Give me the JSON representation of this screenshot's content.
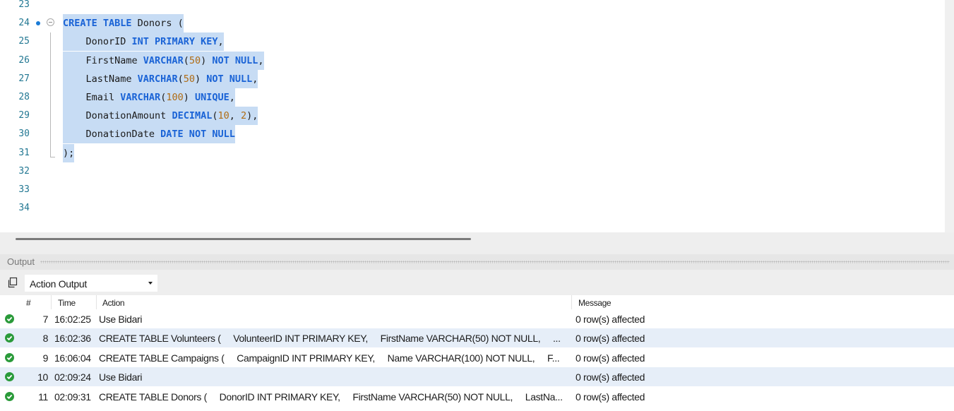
{
  "editor": {
    "lines": [
      {
        "n": "23",
        "tokens": []
      },
      {
        "n": "24",
        "tokens": [
          {
            "t": "CREATE TABLE",
            "c": "kw"
          },
          {
            "t": " Donors (",
            "c": "tx"
          }
        ]
      },
      {
        "n": "25",
        "tokens": [
          {
            "t": "    DonorID ",
            "c": "tx"
          },
          {
            "t": "INT PRIMARY KEY",
            "c": "kw"
          },
          {
            "t": ",",
            "c": "tx"
          }
        ]
      },
      {
        "n": "26",
        "tokens": [
          {
            "t": "    FirstName ",
            "c": "tx"
          },
          {
            "t": "VARCHAR",
            "c": "kw"
          },
          {
            "t": "(",
            "c": "tx"
          },
          {
            "t": "50",
            "c": "num"
          },
          {
            "t": ") ",
            "c": "tx"
          },
          {
            "t": "NOT NULL",
            "c": "kw"
          },
          {
            "t": ",",
            "c": "tx"
          }
        ]
      },
      {
        "n": "27",
        "tokens": [
          {
            "t": "    LastName ",
            "c": "tx"
          },
          {
            "t": "VARCHAR",
            "c": "kw"
          },
          {
            "t": "(",
            "c": "tx"
          },
          {
            "t": "50",
            "c": "num"
          },
          {
            "t": ") ",
            "c": "tx"
          },
          {
            "t": "NOT NULL",
            "c": "kw"
          },
          {
            "t": ",",
            "c": "tx"
          }
        ]
      },
      {
        "n": "28",
        "tokens": [
          {
            "t": "    Email ",
            "c": "tx"
          },
          {
            "t": "VARCHAR",
            "c": "kw"
          },
          {
            "t": "(",
            "c": "tx"
          },
          {
            "t": "100",
            "c": "num"
          },
          {
            "t": ") ",
            "c": "tx"
          },
          {
            "t": "UNIQUE",
            "c": "kw"
          },
          {
            "t": ",",
            "c": "tx"
          }
        ]
      },
      {
        "n": "29",
        "tokens": [
          {
            "t": "    DonationAmount ",
            "c": "tx"
          },
          {
            "t": "DECIMAL",
            "c": "kw"
          },
          {
            "t": "(",
            "c": "tx"
          },
          {
            "t": "10",
            "c": "num"
          },
          {
            "t": ", ",
            "c": "tx"
          },
          {
            "t": "2",
            "c": "num"
          },
          {
            "t": "),",
            "c": "tx"
          }
        ]
      },
      {
        "n": "30",
        "tokens": [
          {
            "t": "    DonationDate ",
            "c": "tx"
          },
          {
            "t": "DATE NOT NULL",
            "c": "kw"
          }
        ]
      },
      {
        "n": "31",
        "tokens": [
          {
            "t": ");",
            "c": "tx"
          }
        ]
      },
      {
        "n": "32",
        "tokens": []
      },
      {
        "n": "33",
        "tokens": []
      },
      {
        "n": "34",
        "tokens": []
      }
    ]
  },
  "output": {
    "title": "Output",
    "select_value": "Action Output",
    "columns": [
      "#",
      "Time",
      "Action",
      "Message"
    ],
    "rows": [
      {
        "num": "7",
        "time": "16:02:25",
        "action": "Use Bidari",
        "message": "0 row(s) affected"
      },
      {
        "num": "8",
        "time": "16:02:36",
        "action": "CREATE TABLE Volunteers (     VolunteerID INT PRIMARY KEY,     FirstName VARCHAR(50) NOT NULL,     ...",
        "message": "0 row(s) affected"
      },
      {
        "num": "9",
        "time": "16:06:04",
        "action": "CREATE TABLE Campaigns (     CampaignID INT PRIMARY KEY,     Name VARCHAR(100) NOT NULL,     F...",
        "message": "0 row(s) affected"
      },
      {
        "num": "10",
        "time": "02:09:24",
        "action": "Use Bidari",
        "message": "0 row(s) affected"
      },
      {
        "num": "11",
        "time": "02:09:31",
        "action": "CREATE TABLE Donors (     DonorID INT PRIMARY KEY,     FirstName VARCHAR(50) NOT NULL,     LastNa...",
        "message": "0 row(s) affected"
      }
    ]
  },
  "colors": {
    "keyword": "#1a63d6",
    "number": "#b06c14",
    "selection": "#c7dcf4",
    "success": "#2a9a3a",
    "row_alt": "#e6eef8"
  },
  "icons": {
    "breakpoint": "breakpoint-dot-icon",
    "fold": "fold-collapse-icon",
    "copy": "copy-icon",
    "status": "success-check-icon"
  }
}
